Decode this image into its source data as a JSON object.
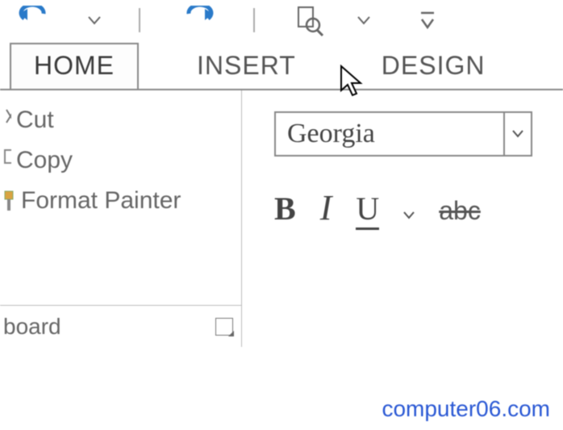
{
  "qat": {
    "undo_color": "#2a7ac9",
    "redo_color": "#2a7ac9"
  },
  "tabs": {
    "home": "HOME",
    "insert": "INSERT",
    "design": "DESIGN",
    "active": "home"
  },
  "clipboard": {
    "cut": "Cut",
    "copy": "Copy",
    "format_painter": "Format Painter",
    "group_label": "board"
  },
  "font": {
    "selected": "Georgia",
    "bold": "B",
    "italic": "I",
    "underline": "U",
    "strike": "abc"
  },
  "watermark": "computer06.com"
}
